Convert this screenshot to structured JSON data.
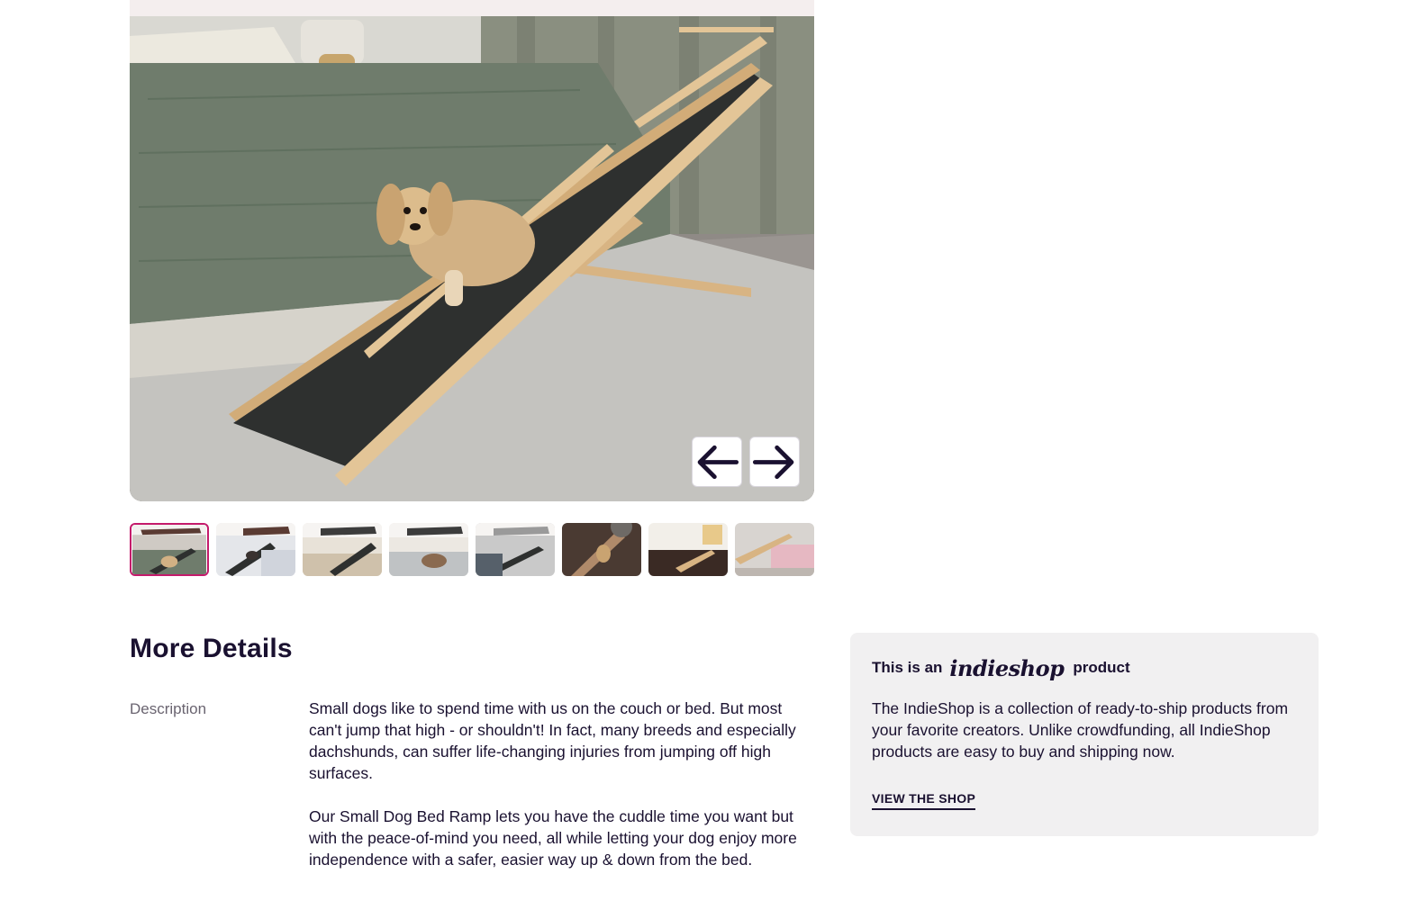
{
  "gallery": {
    "main_image_alt": "Small dog bed ramp with dachshund",
    "prev_icon": "arrow-left-icon",
    "next_icon": "arrow-right-icon",
    "thumbnail_count": 8,
    "active_thumbnail": 1
  },
  "details": {
    "title": "More Details",
    "description_label": "Description",
    "paragraphs": [
      "Small dogs like to spend time with us on the couch or bed. But most can't jump that high - or shouldn't! In fact, many breeds and especially dachshunds, can suffer life-changing injuries from jumping off high surfaces.",
      "Our Small Dog Bed Ramp lets you have the cuddle time you want but with the peace-of-mind you need, all while letting your dog enjoy more independence with a safer, easier way up & down from the bed."
    ]
  },
  "indieshop": {
    "prefix": "This is an",
    "logo": "indieshop",
    "suffix": "product",
    "body": "The IndieShop is a collection of ready-to-ship products from your favorite creators. Unlike crowdfunding, all IndieShop products are easy to buy and shipping now.",
    "link_label": "VIEW THE SHOP"
  },
  "colors": {
    "accent": "#c41a6b",
    "text": "#1a1130",
    "card_bg": "#f1f0f1"
  }
}
